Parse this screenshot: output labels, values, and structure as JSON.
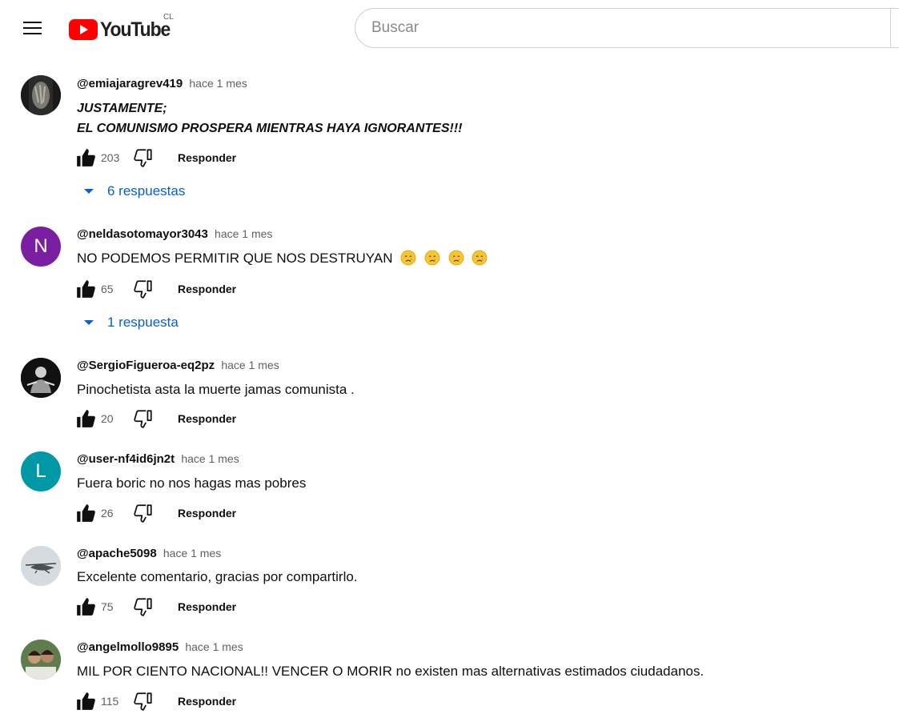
{
  "header": {
    "logo_text": "YouTube",
    "country_code": "CL",
    "search_placeholder": "Buscar"
  },
  "colors": {
    "brand_red": "#ff0000",
    "link_blue": "#065fd4",
    "avatar_purple": "#7b1fa2",
    "avatar_teal": "#0097a7"
  },
  "comments": [
    {
      "author": "@emiajaragrev419",
      "time": "hace 1 mes",
      "text_lines": [
        "JUSTAMENTE;",
        "EL COMUNISMO PROSPERA MIENTRAS HAYA IGNORANTES!!!"
      ],
      "likes": "203",
      "reply_label": "Responder",
      "replies_label": "6 respuestas"
    },
    {
      "author": "@neldasotomayor3043",
      "time": "hace 1 mes",
      "avatar_letter": "N",
      "text": "NO PODEMOS PERMITIR QUE NOS DESTRUYAN",
      "text_emojis": [
        "crying-face",
        "crying-face",
        "crying-face",
        "crying-face"
      ],
      "likes": "65",
      "reply_label": "Responder",
      "replies_label": "1 respuesta"
    },
    {
      "author": "@SergioFigueroa-eq2pz",
      "time": "hace 1 mes",
      "text": "Pinochetista asta la muerte jamas comunista .",
      "likes": "20",
      "reply_label": "Responder"
    },
    {
      "author": "@user-nf4id6jn2t",
      "time": "hace 1 mes",
      "avatar_letter": "L",
      "text": "Fuera boric no nos hagas mas pobres",
      "likes": "26",
      "reply_label": "Responder"
    },
    {
      "author": "@apache5098",
      "time": "hace 1 mes",
      "text": "Excelente comentario, gracias por compartirlo.",
      "likes": "75",
      "reply_label": "Responder"
    },
    {
      "author": "@angelmollo9895",
      "time": "hace 1 mes",
      "text": "MIL POR CIENTO NACIONAL!! VENCER O MORIR no existen mas alternativas estimados ciudadanos.",
      "likes": "115",
      "reply_label": "Responder"
    }
  ]
}
